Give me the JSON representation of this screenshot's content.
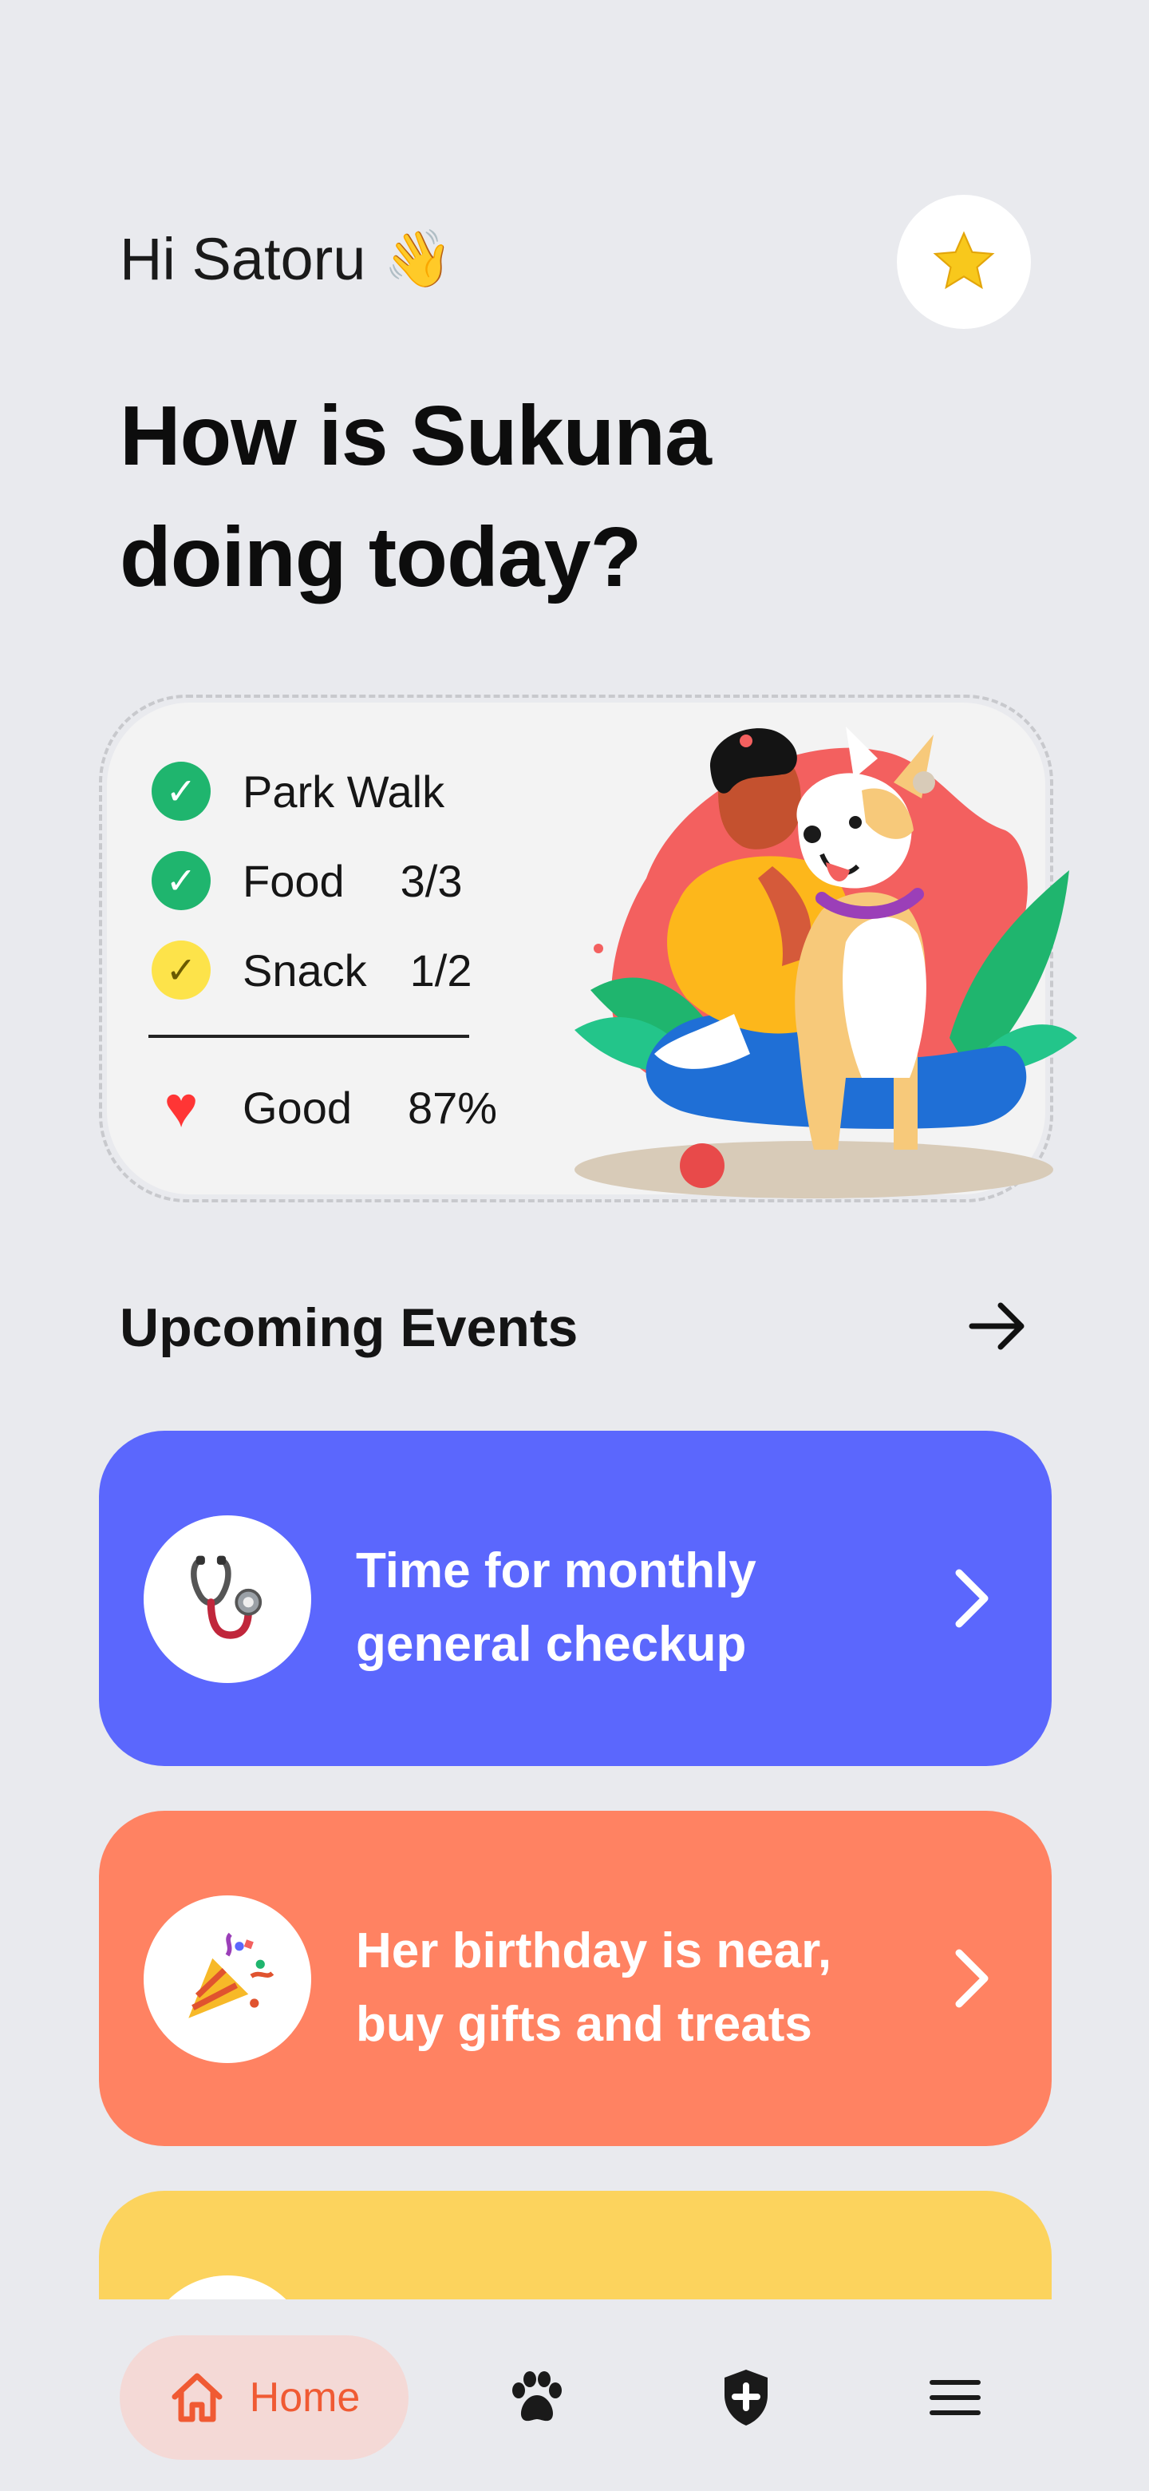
{
  "header": {
    "greeting": "Hi Satoru",
    "wave_emoji": "👋",
    "favorite_icon": "star-icon",
    "headline": "How is Sukuna doing today?"
  },
  "status": {
    "items": [
      {
        "label": "Park Walk",
        "value": "",
        "state": "done",
        "color": "#1fb56e"
      },
      {
        "label": "Food",
        "value": "3/3",
        "state": "done",
        "color": "#1fb56e"
      },
      {
        "label": "Snack",
        "value": "1/2",
        "state": "partial",
        "color": "#fde34a"
      }
    ],
    "health": {
      "label": "Good",
      "value": "87%",
      "icon": "heart-icon",
      "color": "#ff3535"
    }
  },
  "events": {
    "title": "Upcoming Events",
    "items": [
      {
        "text": "Time for monthly general checkup",
        "icon": "stethoscope-icon",
        "emoji": "🩺",
        "color": "#5b67fd"
      },
      {
        "text": "Her birthday is near, buy gifts and treats",
        "icon": "party-popper-icon",
        "emoji": "🎉",
        "color": "#ff8262"
      },
      {
        "text": "",
        "icon": "",
        "emoji": "",
        "color": "#fcd35d"
      }
    ]
  },
  "nav": {
    "home_label": "Home",
    "items": [
      "home-icon",
      "paw-icon",
      "shield-icon",
      "menu-icon"
    ],
    "active_color": "#f05a33"
  }
}
